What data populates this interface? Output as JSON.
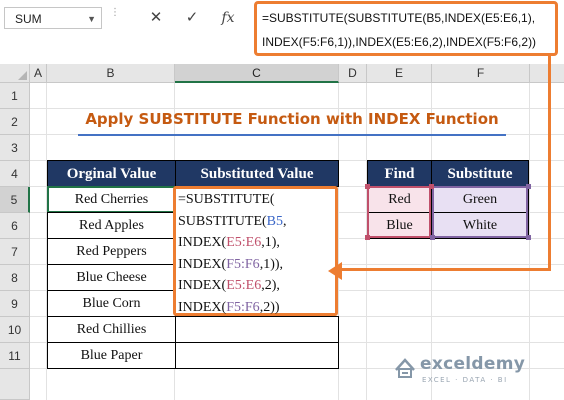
{
  "formula_bar": {
    "name_box": "SUM",
    "cancel_icon": "✕",
    "enter_icon": "✓",
    "fx_label": "fx",
    "formula_line1": "=SUBSTITUTE(SUBSTITUTE(B5,INDEX(E5:E6,1),",
    "formula_line2": "INDEX(F5:F6,1)),INDEX(E5:E6,2),INDEX(F5:F6,2))"
  },
  "columns": [
    "A",
    "B",
    "C",
    "D",
    "E",
    "F"
  ],
  "rows": [
    "1",
    "2",
    "3",
    "4",
    "5",
    "6",
    "7",
    "8",
    "9",
    "10",
    "11"
  ],
  "title": "Apply SUBSTITUTE Function with INDEX Function",
  "main_table": {
    "headers": [
      "Orginal Value",
      "Substituted Value"
    ],
    "values": [
      "Red Cherries",
      "Red Apples",
      "Red Peppers",
      "Blue Cheese",
      "Blue Corn",
      "Red Chillies",
      "Blue Paper"
    ]
  },
  "formula_cell": {
    "l1": "=SUBSTITUTE(",
    "l2a": "SUBSTITUTE(",
    "l2b": "B5",
    "l2c": ",",
    "l3a": "INDEX(",
    "l3b": "E5:E6",
    "l3c": ",1),",
    "l4a": "INDEX(",
    "l4b": "F5:F6",
    "l4c": ",1)),",
    "l5a": "INDEX(",
    "l5b": "E5:E6",
    "l5c": ",2),",
    "l6a": "INDEX(",
    "l6b": "F5:F6",
    "l6c": ",2))"
  },
  "lookup_table": {
    "headers": [
      "Find",
      "Substitute"
    ],
    "rows": [
      {
        "find": "Red",
        "substitute": "Green"
      },
      {
        "find": "Blue",
        "substitute": "White"
      }
    ]
  },
  "watermark": {
    "name": "exceldemy",
    "tagline": "EXCEL · DATA · BI"
  },
  "colors": {
    "accent_orange": "#ed7d31",
    "header_navy": "#203864",
    "title_orange": "#c55a11",
    "excel_green": "#217346"
  }
}
